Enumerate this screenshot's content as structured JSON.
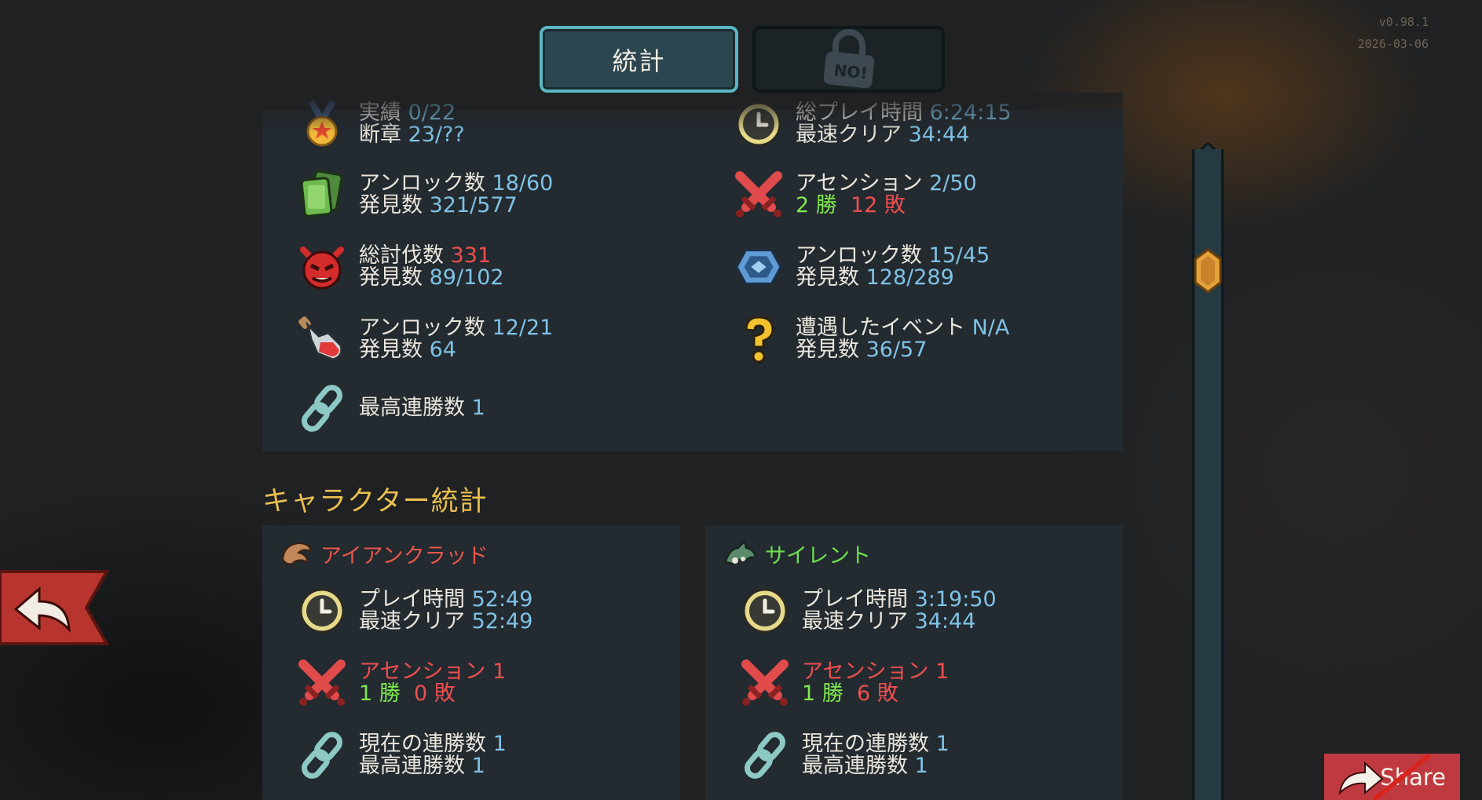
{
  "version": {
    "line1": "v0.98.1",
    "line2": "2026-03-06"
  },
  "tabs": {
    "stats": "統計"
  },
  "overall": {
    "achievements_label": "実績",
    "achievements_value": "0/22",
    "fragments_label": "断章",
    "fragments_value": "23/??",
    "playtime_label": "総プレイ時間",
    "playtime_value": "6:24:15",
    "fastest_label": "最速クリア",
    "fastest_value": "34:44",
    "cards_unlock_label": "アンロック数",
    "cards_unlock_value": "18/60",
    "cards_seen_label": "発見数",
    "cards_seen_value": "321/577",
    "ascension_label": "アセンション",
    "ascension_value": "2/50",
    "wins_value": "2 勝",
    "losses_value": "12 敗",
    "kills_label": "総討伐数",
    "kills_value": "331",
    "monsters_seen_label": "発見数",
    "monsters_seen_value": "89/102",
    "relics_unlock_label": "アンロック数",
    "relics_unlock_value": "15/45",
    "relics_seen_label": "発見数",
    "relics_seen_value": "128/289",
    "potions_unlock_label": "アンロック数",
    "potions_unlock_value": "12/21",
    "potions_seen_label": "発見数",
    "potions_seen_value": "64",
    "events_label": "遭遇したイベント",
    "events_value": "N/A",
    "events_seen_label": "発見数",
    "events_seen_value": "36/57",
    "best_streak_label": "最高連勝数",
    "best_streak_value": "1"
  },
  "character_section_title": "キャラクター統計",
  "characters": [
    {
      "name": "アイアンクラッド",
      "playtime_label": "プレイ時間",
      "playtime_value": "52:49",
      "fastest_label": "最速クリア",
      "fastest_value": "52:49",
      "ascension_label": "アセンション",
      "ascension_value": "1",
      "wins_value": "1 勝",
      "losses_value": "0 敗",
      "current_streak_label": "現在の連勝数",
      "current_streak_value": "1",
      "best_streak_label": "最高連勝数",
      "best_streak_value": "1"
    },
    {
      "name": "サイレント",
      "playtime_label": "プレイ時間",
      "playtime_value": "3:19:50",
      "fastest_label": "最速クリア",
      "fastest_value": "34:44",
      "ascension_label": "アセンション",
      "ascension_value": "1",
      "wins_value": "1 勝",
      "losses_value": "6 敗",
      "current_streak_label": "現在の連勝数",
      "current_streak_value": "1",
      "best_streak_label": "最高連勝数",
      "best_streak_value": "1"
    }
  ],
  "share": {
    "label": "Share"
  },
  "colors": {
    "accent_value": "#7fc3e6",
    "red": "#ee4f4f",
    "green": "#7ee84e",
    "gold": "#e9bf4e"
  }
}
